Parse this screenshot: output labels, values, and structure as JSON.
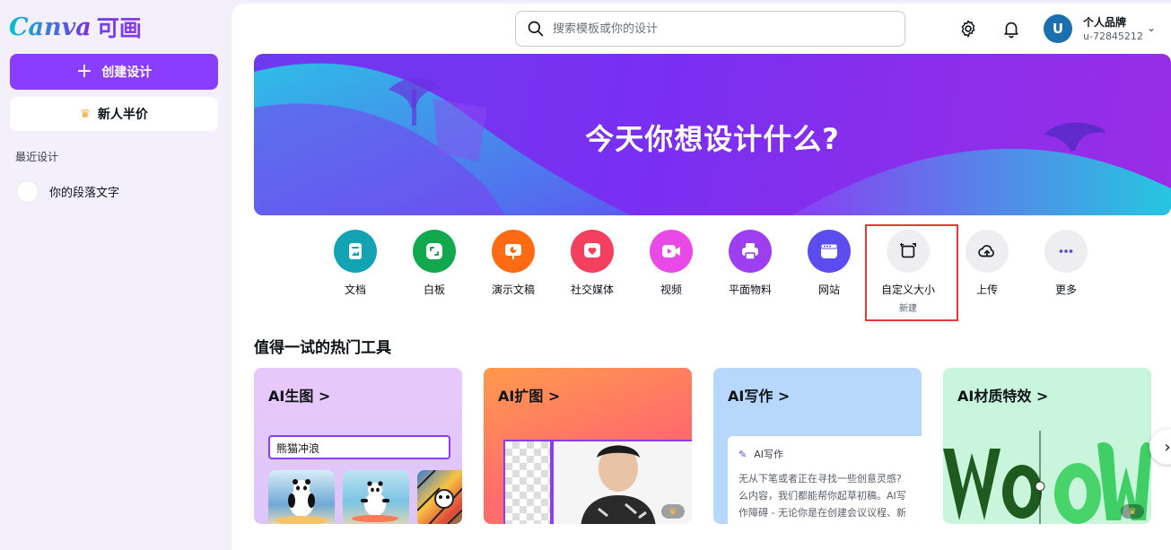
{
  "sidebar": {
    "logo_text": "Canva",
    "logo_cn": "可画",
    "create_label": "创建设计",
    "promo_label": "新人半价",
    "recent_label": "最近设计",
    "recent_items": [
      {
        "label": "你的段落文字"
      }
    ]
  },
  "header": {
    "search_placeholder": "搜索模板或你的设计",
    "avatar_letter": "U",
    "account_name": "个人品牌",
    "account_id": "u-72845212"
  },
  "banner": {
    "title": "今天你想设计什么?"
  },
  "categories": [
    {
      "label": "文档",
      "color": "#13a3b5",
      "icon": "document-icon"
    },
    {
      "label": "白板",
      "color": "#11a84e",
      "icon": "whiteboard-icon"
    },
    {
      "label": "演示文稿",
      "color": "#ff6a13",
      "icon": "presentation-icon"
    },
    {
      "label": "社交媒体",
      "color": "#f43f5e",
      "icon": "heart-icon"
    },
    {
      "label": "视频",
      "color": "#e94ae7",
      "icon": "video-icon"
    },
    {
      "label": "平面物料",
      "color": "#9d3ff0",
      "icon": "printer-icon"
    },
    {
      "label": "网站",
      "color": "#5b4cf0",
      "icon": "website-icon"
    },
    {
      "label": "自定义大小",
      "sub": "新建",
      "color": "#eeeef0",
      "icon": "custom-size-icon"
    },
    {
      "label": "上传",
      "color": "#eeeef0",
      "icon": "upload-cloud-icon"
    },
    {
      "label": "更多",
      "color": "#eeeef0",
      "icon": "more-icon"
    }
  ],
  "tools": {
    "section_title": "值得一试的热门工具",
    "cards": [
      {
        "title": "AI生图 >",
        "input_value": "熊猫冲浪"
      },
      {
        "title": "AI扩图 >"
      },
      {
        "title": "AI写作 >",
        "box_title": "AI写作",
        "box_lines": [
          "无从下笔或者正在寻找一些创意灵感?",
          "么内容，我们都能帮你起草初稿。AI写",
          "作障碍 - 无论你是在创建会议议程、新"
        ]
      },
      {
        "title": "AI材质特效 >"
      }
    ]
  }
}
